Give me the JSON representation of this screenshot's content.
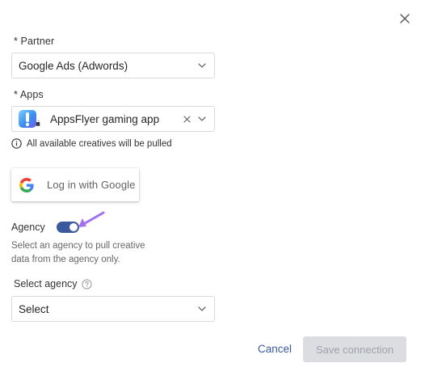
{
  "partner": {
    "label": "* Partner",
    "selected": "Google Ads (Adwords)"
  },
  "apps": {
    "label": "* Apps",
    "selected": "AppsFlyer gaming app",
    "info_text": "All available creatives will be pulled"
  },
  "google_login": {
    "label": "Log in with Google"
  },
  "agency": {
    "label": "Agency",
    "toggle_on": true,
    "help_text": "Select an agency to pull creative data from the agency only.",
    "select_label": "Select agency",
    "select_value": "Select"
  },
  "footer": {
    "cancel_label": "Cancel",
    "save_label": "Save connection"
  },
  "colors": {
    "accent": "#3b5a9e",
    "annotation_arrow": "#a070f0",
    "disabled_button_bg": "#dcdde1",
    "disabled_button_text": "#9ea2ab"
  }
}
